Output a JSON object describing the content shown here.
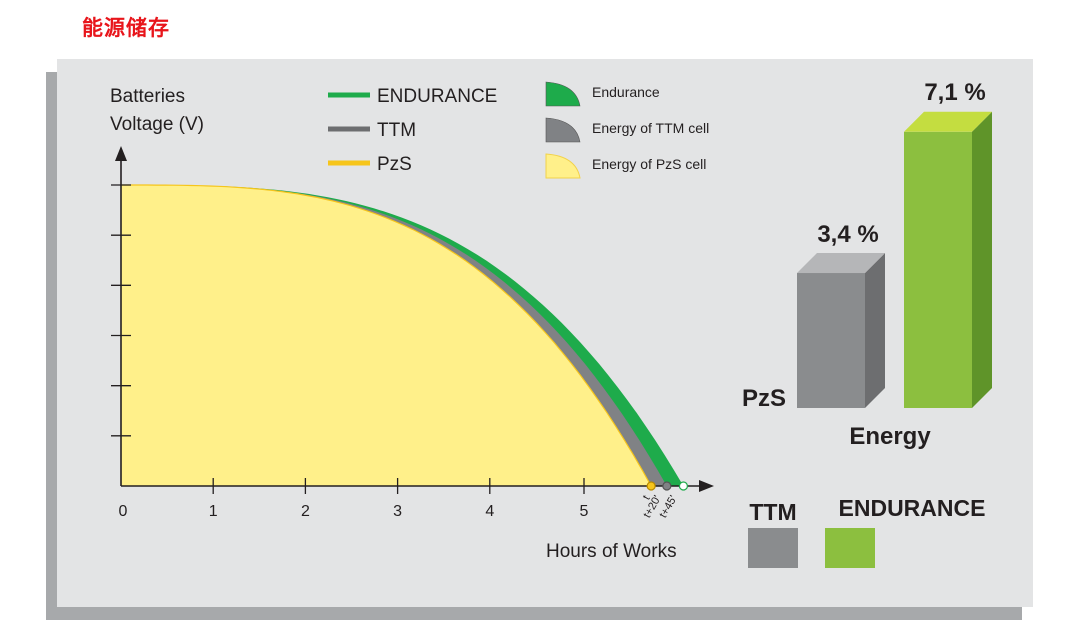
{
  "page": {
    "title": "能源储存"
  },
  "colors": {
    "endurance": "#1eab4b",
    "ttm": "#6d6e70",
    "pzs": "#fff08a",
    "pzs_line": "#f6c51b",
    "bar_gray": "#8a8c8e",
    "bar_green": "#8cbf3f",
    "axis": "#231f20"
  },
  "chart_data": [
    {
      "type": "area",
      "ylabel": "Batteries\nVoltage (V)",
      "xlabel": "Hours of Works",
      "x_ticks": [
        "0",
        "1",
        "2",
        "3",
        "4",
        "5"
      ],
      "x_extra_ticks": [
        "t",
        "t+20'",
        "t+45'"
      ],
      "xlim": [
        0,
        6.3
      ],
      "y_tick_count": 6,
      "legend_lines": [
        {
          "label": "ENDURANCE",
          "color": "#1eab4b"
        },
        {
          "label": "TTM",
          "color": "#6d6e70"
        },
        {
          "label": "PzS",
          "color": "#f6c51b"
        }
      ],
      "legend_areas": [
        {
          "label": "Endurance",
          "color": "#1eab4b"
        },
        {
          "label": "Energy of TTM cell",
          "color": "#808285"
        },
        {
          "label": "Energy of PzS cell",
          "color": "#fff08a"
        }
      ],
      "series": [
        {
          "name": "PzS",
          "end_hours": 5.75
        },
        {
          "name": "TTM",
          "end_hours": 5.92
        },
        {
          "name": "ENDURANCE",
          "end_hours": 6.1
        }
      ]
    },
    {
      "type": "bar",
      "title": "Energy",
      "categories": [
        "PzS",
        "TTM",
        "ENDURANCE"
      ],
      "values": [
        0,
        3.4,
        7.1
      ],
      "value_labels": [
        "",
        "3,4 %",
        "7,1 %"
      ],
      "legend": [
        {
          "label": "TTM",
          "color": "#8a8c8e"
        },
        {
          "label": "ENDURANCE",
          "color": "#8cbf3f"
        }
      ]
    }
  ]
}
